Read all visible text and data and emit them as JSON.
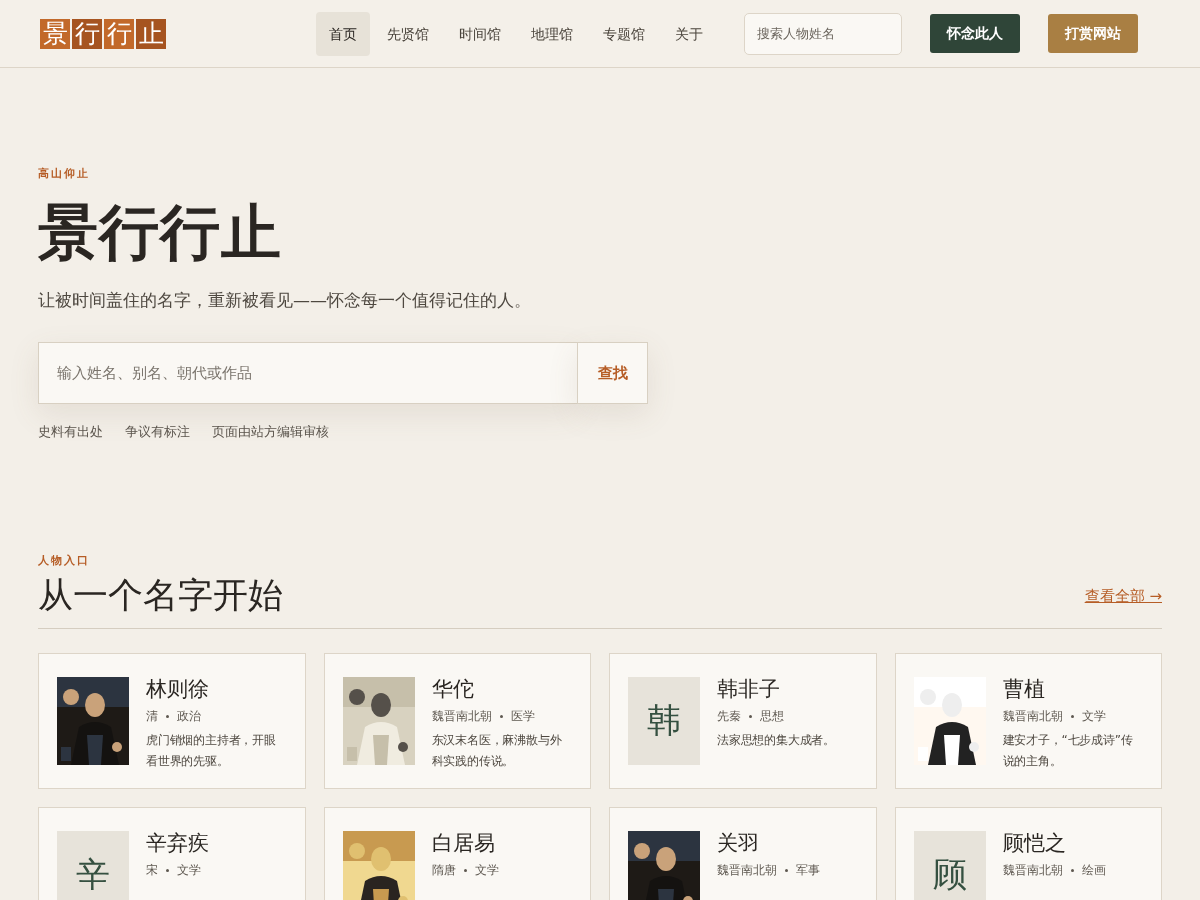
{
  "header": {
    "logo": [
      "景",
      "行",
      "行",
      "止"
    ],
    "nav": [
      {
        "label": "首页",
        "selected": true
      },
      {
        "label": "先贤馆",
        "selected": false
      },
      {
        "label": "时间馆",
        "selected": false
      },
      {
        "label": "地理馆",
        "selected": false
      },
      {
        "label": "专题馆",
        "selected": false
      },
      {
        "label": "关于",
        "selected": false
      }
    ],
    "search": {
      "placeholder": "搜索人物姓名"
    },
    "buttons": [
      {
        "label": "怀念此人",
        "kind": "primary"
      },
      {
        "label": "打赏网站",
        "kind": "accent"
      }
    ]
  },
  "hero": {
    "eyebrow": "高山仰止",
    "title": "景行行止",
    "subtitle": "让被时间盖住的名字，重新被看见——怀念每一个值得记住的人。",
    "search": {
      "placeholder": "输入姓名、别名、朝代或作品",
      "button": "查找"
    },
    "notes": [
      "史料有出处",
      "争议有标注",
      "页面由站方编辑审核"
    ]
  },
  "section": {
    "eyebrow": "人物入口",
    "title": "从一个名字开始",
    "link": "查看全部 →",
    "cards": [
      {
        "name": "林则徐",
        "dynasty": "清",
        "field": "政治",
        "desc": "虎门销烟的主持者，开眼看世界的先驱。"
      },
      {
        "name": "华佗",
        "dynasty": "魏晋南北朝",
        "field": "医学",
        "desc": "东汉末名医，麻沸散与外科实践的传说。"
      },
      {
        "name": "韩非子",
        "dynasty": "先秦",
        "field": "思想",
        "desc": "法家思想的集大成者。",
        "image": {
          "kind": "initial",
          "char": "韩"
        }
      },
      {
        "name": "曹植",
        "dynasty": "魏晋南北朝",
        "field": "文学",
        "desc": "建安才子，“七步成诗”传说的主角。"
      },
      {
        "name": "辛弃疾",
        "dynasty": "宋",
        "field": "文学",
        "image": {
          "kind": "initial",
          "char": "辛"
        }
      },
      {
        "name": "白居易",
        "dynasty": "隋唐",
        "field": "文学"
      },
      {
        "name": "关羽",
        "dynasty": "魏晋南北朝",
        "field": "军事"
      },
      {
        "name": "顾恺之",
        "dynasty": "魏晋南北朝",
        "field": "绘画",
        "image": {
          "kind": "initial",
          "char": "顾"
        }
      }
    ]
  }
}
